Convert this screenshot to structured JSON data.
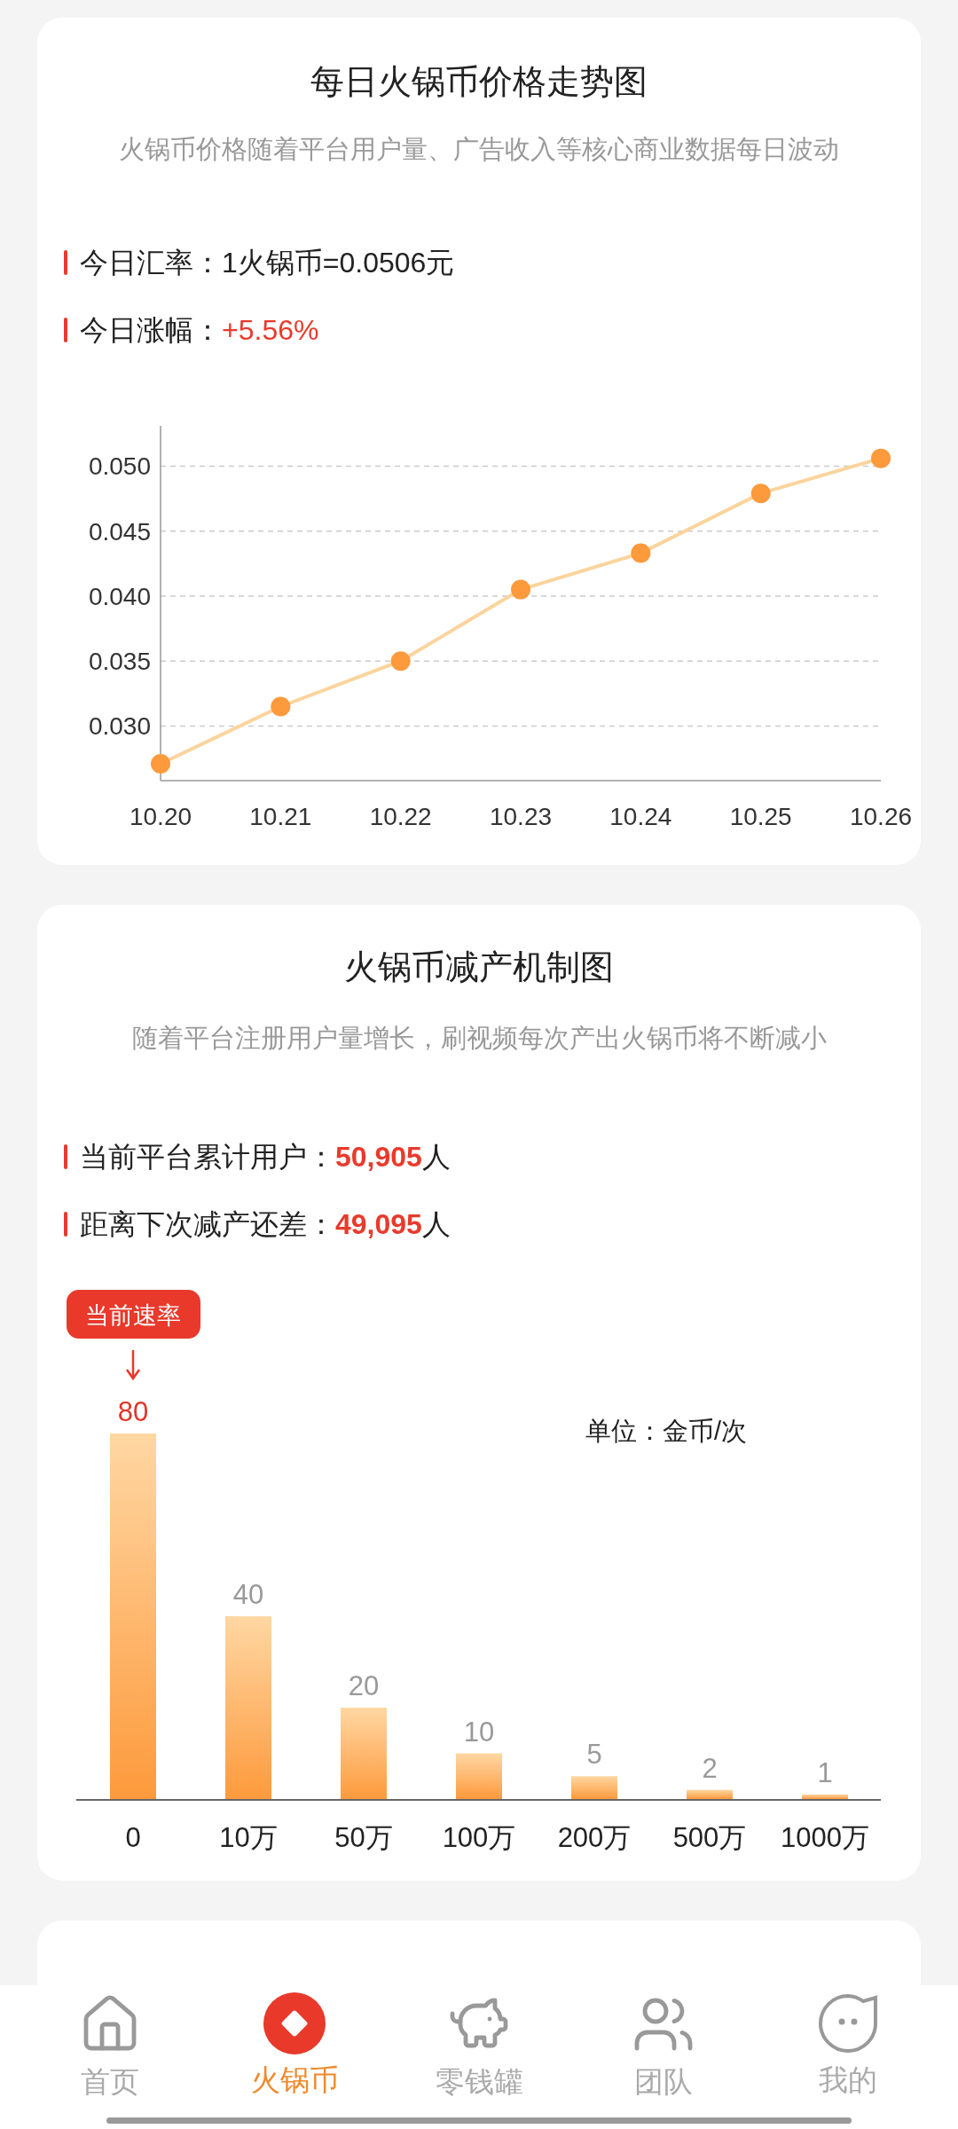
{
  "price_card": {
    "title": "每日火锅币价格走势图",
    "subtitle": "火锅币价格随着平台用户量、广告收入等核心商业数据每日波动",
    "stats": [
      {
        "label": "今日汇率：",
        "value": "1火锅币=0.0506元",
        "highlight": false
      },
      {
        "label": "今日涨幅：",
        "value": "+5.56%",
        "highlight": true
      }
    ],
    "chart_data": {
      "type": "line",
      "categories": [
        "10.20",
        "10.21",
        "10.22",
        "10.23",
        "10.24",
        "10.25",
        "10.26"
      ],
      "series": [
        {
          "color": "#fd9a3c",
          "values": [
            0.0271,
            0.0315,
            0.035,
            0.0405,
            0.0433,
            0.0479,
            0.0506
          ],
          "marker": true
        }
      ],
      "grid": true,
      "ylim": [
        0.0258,
        0.0531
      ],
      "yticks": [
        {
          "value": 0.03,
          "label": "0.030"
        },
        {
          "value": 0.035,
          "label": "0.035"
        },
        {
          "value": 0.04,
          "label": "0.040"
        },
        {
          "value": 0.045,
          "label": "0.045"
        },
        {
          "value": 0.05,
          "label": "0.050"
        }
      ]
    }
  },
  "reduction_card": {
    "title": "火锅币减产机制图",
    "subtitle": "随着平台注册用户量增长，刷视频每次产出火锅币将不断减小",
    "stats": [
      {
        "label": "当前平台累计用户：",
        "value": "50,905",
        "unit": "人"
      },
      {
        "label": "距离下次减产还差：",
        "value": "49,095",
        "unit": "人"
      }
    ],
    "badge": "当前速率",
    "unit_label": "单位：金币/次",
    "bar_states": [
      {
        "selected": true
      },
      {
        "selected": false
      },
      {
        "selected": false
      },
      {
        "selected": false
      },
      {
        "selected": false
      },
      {
        "selected": false
      },
      {
        "selected": false
      }
    ],
    "chart_data": {
      "type": "bar",
      "categories": [
        "0",
        "10万",
        "50万",
        "100万",
        "200万",
        "500万",
        "1000万"
      ],
      "series": [
        {
          "color": "#fd9a3c",
          "values": [
            80,
            40,
            20,
            10,
            5,
            2,
            1
          ]
        }
      ],
      "ylim": [
        0,
        80
      ],
      "data_labels": true
    }
  },
  "tab_bar": [
    {
      "label": "首页",
      "kind": "home",
      "selected": false
    },
    {
      "label": "火锅币",
      "kind": "coin",
      "selected": true
    },
    {
      "label": "零钱罐",
      "kind": "piggy",
      "selected": false
    },
    {
      "label": "团队",
      "kind": "team",
      "selected": false
    },
    {
      "label": "我的",
      "kind": "me",
      "selected": false
    }
  ]
}
